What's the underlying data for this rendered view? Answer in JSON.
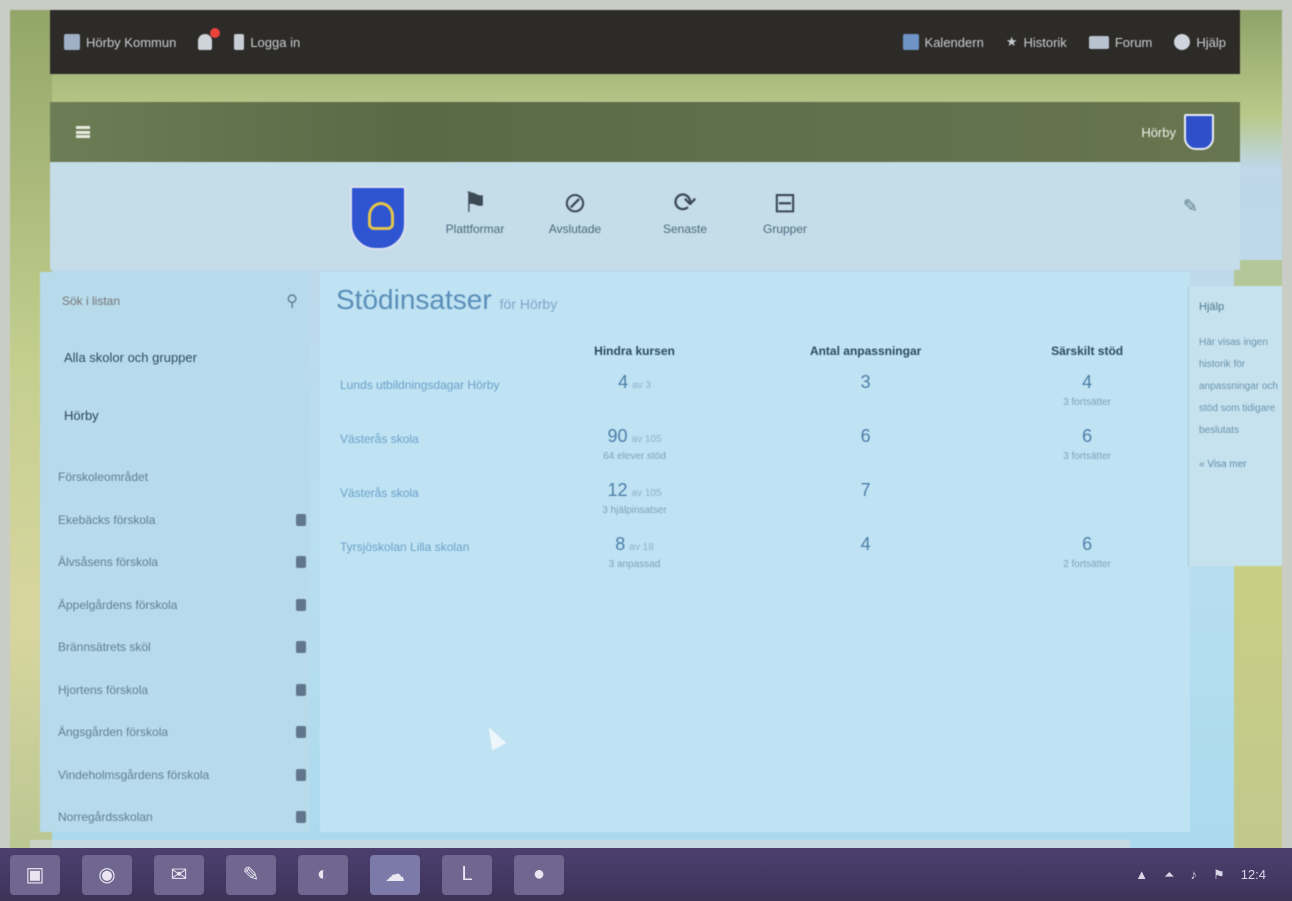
{
  "topbar": {
    "site": "Hörby Kommun",
    "login": "Logga in",
    "right_items": [
      {
        "icon": "calendar-icon",
        "label": "Kalendern"
      },
      {
        "icon": "star-icon",
        "label": "Historik"
      },
      {
        "icon": "chat-icon",
        "label": "Forum"
      },
      {
        "icon": "help-icon",
        "label": "Hjälp"
      }
    ]
  },
  "band": {
    "user": "Hörby"
  },
  "nav": [
    {
      "glyph": "⚑",
      "icon": "flag-icon",
      "label": "Plattformar"
    },
    {
      "glyph": "⊘",
      "icon": "blocked-icon",
      "label": "Avslutade"
    },
    {
      "glyph": "⟳",
      "icon": "refresh-icon",
      "label": "Senaste"
    },
    {
      "glyph": "⊟",
      "icon": "board-icon",
      "label": "Grupper"
    }
  ],
  "sidebar": {
    "search_placeholder": "Sök i listan",
    "heading": "Alla skolor och grupper",
    "subheading": "Hörby",
    "items": [
      "Förskoleområdet",
      "Ekebäcks förskola",
      "Älvsåsens förskola",
      "Äppelgårdens förskola",
      "Brännsätrets sköl",
      "Hjortens förskola",
      "Ängsgården förskola",
      "Vindeholmsgårdens förskola",
      "Norregårdsskolan"
    ]
  },
  "main": {
    "title": "Stödinsatser",
    "title_sub": "för Hörby",
    "columns": [
      "",
      "Hindra kursen",
      "Antal anpassningar",
      "Särskilt stöd"
    ],
    "rows": [
      {
        "name": "Lunds utbildningsdagar Hörby",
        "col1": "4",
        "col1_small": "av 3",
        "col1_note": "",
        "col2": "3",
        "col3": "4",
        "col3_note": "3 fortsätter"
      },
      {
        "name": "Västerås skola",
        "col1": "90",
        "col1_small": "av 105",
        "col1_note": "64 elever stöd",
        "col2": "6",
        "col3": "6",
        "col3_note": "3 fortsätter"
      },
      {
        "name": "Västerås skola",
        "col1": "12",
        "col1_small": "av 105",
        "col1_note": "3 hjälpinsatser",
        "col2": "7",
        "col3": "",
        "col3_note": ""
      },
      {
        "name": "Tyrsjöskolan Lilla skolan",
        "col1": "8",
        "col1_small": "av 18",
        "col1_note": "3 anpassad",
        "col2": "4",
        "col3": "6",
        "col3_note": "2 fortsätter"
      }
    ]
  },
  "popover": {
    "head": "Hjälp",
    "text": "Här visas ingen historik för anpassningar och stöd som tidigare beslutats",
    "link": "« Visa mer"
  },
  "taskbar": {
    "buttons": [
      "▣",
      "◉",
      "✉",
      "✎",
      "◐",
      "☁",
      "L",
      "●"
    ],
    "tray": [
      "▲",
      "⏶",
      "♪",
      "⚑",
      "12:4"
    ]
  }
}
